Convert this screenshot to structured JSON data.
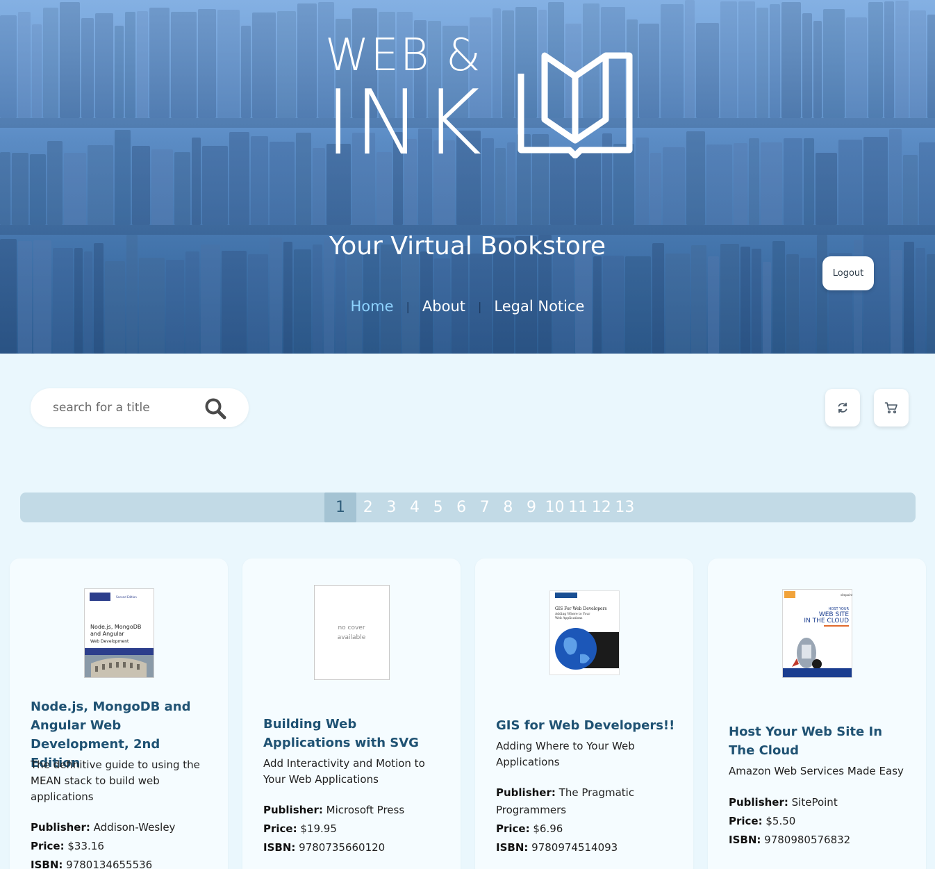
{
  "header": {
    "logo_line1": "WEB &",
    "logo_line2": "INK",
    "tagline": "Your Virtual Bookstore",
    "nav": [
      {
        "label": "Home",
        "active": true
      },
      {
        "label": "About",
        "active": false
      },
      {
        "label": "Legal Notice",
        "active": false
      }
    ],
    "logout_label": "Logout"
  },
  "toolbar": {
    "search_placeholder": "search for a title",
    "refresh_icon": "refresh-icon",
    "cart_icon": "cart-icon"
  },
  "pagination": {
    "pages": [
      "1",
      "2",
      "3",
      "4",
      "5",
      "6",
      "7",
      "8",
      "9",
      "10",
      "11",
      "12",
      "13"
    ],
    "current": "1"
  },
  "books": [
    {
      "title": "Node.js, MongoDB and Angular Web Development, 2nd Edition",
      "subtitle": "The definitive guide to using the MEAN stack to build web applications",
      "publisher_label": "Publisher:",
      "publisher": "Addison-Wesley",
      "price_label": "Price:",
      "price": "$33.16",
      "isbn_label": "ISBN:",
      "isbn": "9780134655536",
      "cover": {
        "type": "image",
        "text_line1": "Node.js, MongoDB",
        "text_line2": "and Angular",
        "text_line3": "Web Development",
        "edition": "Second Edition"
      }
    },
    {
      "title": "Building Web Applications with SVG",
      "subtitle": "Add Interactivity and Motion to Your Web Applications",
      "publisher_label": "Publisher:",
      "publisher": "Microsoft Press",
      "price_label": "Price:",
      "price": "$19.95",
      "isbn_label": "ISBN:",
      "isbn": "9780735660120",
      "cover": {
        "type": "none",
        "text": "no cover available"
      }
    },
    {
      "title": "GIS for Web Developers!!",
      "subtitle": "Adding Where to Your Web Applications",
      "publisher_label": "Publisher:",
      "publisher": "The Pragmatic Programmers",
      "price_label": "Price:",
      "price": "$6.96",
      "isbn_label": "ISBN:",
      "isbn": "9780974514093",
      "cover": {
        "type": "image",
        "text_line1": "GIS For Web Developers",
        "text_line2": "Adding Where to Your",
        "text_line3": "Web Applications"
      }
    },
    {
      "title": "Host Your Web Site In The Cloud",
      "subtitle": "Amazon Web Services Made Easy",
      "publisher_label": "Publisher:",
      "publisher": "SitePoint",
      "price_label": "Price:",
      "price": "$5.50",
      "isbn_label": "ISBN:",
      "isbn": "9780980576832",
      "cover": {
        "type": "image",
        "text_line1": "HOST YOUR",
        "text_line2": "WEB SITE",
        "text_line3": "IN THE CLOUD",
        "brand": "sitepoint"
      }
    }
  ],
  "colors": {
    "accent": "#8fd3ff",
    "title": "#1f5273",
    "page_bg": "#eaf7fd",
    "pagination_bg": "#c2dae6"
  }
}
